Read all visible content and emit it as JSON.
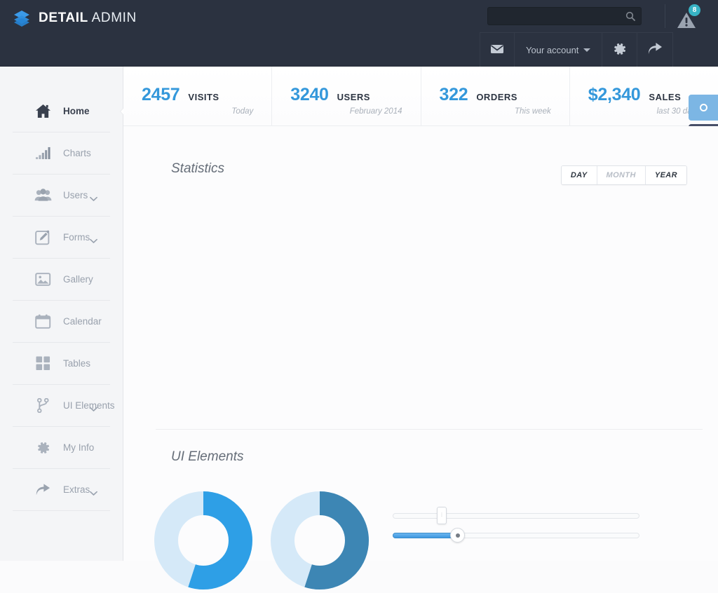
{
  "header": {
    "brand_bold": "DETAIL",
    "brand_light": " ADMIN",
    "logo_icon": "layers-icon",
    "search": {
      "value": "",
      "placeholder": "",
      "icon": "search-icon"
    },
    "alert": {
      "icon": "warning-triangle-icon",
      "badge_count": "8",
      "badge_color": "#37b3c4"
    },
    "tools": [
      {
        "name": "messages",
        "icon": "envelope-icon",
        "label": ""
      },
      {
        "name": "account",
        "icon": "caret-down-icon",
        "label": "Your account"
      },
      {
        "name": "settings",
        "icon": "gear-icon",
        "label": ""
      },
      {
        "name": "logout",
        "icon": "share-arrow-icon",
        "label": ""
      }
    ]
  },
  "sidebar": {
    "items": [
      {
        "label": "Home",
        "icon": "home-icon",
        "active": true,
        "expandable": false
      },
      {
        "label": "Charts",
        "icon": "bar-chart-icon",
        "active": false,
        "expandable": false
      },
      {
        "label": "Users",
        "icon": "users-icon",
        "active": false,
        "expandable": true
      },
      {
        "label": "Forms",
        "icon": "pencil-square-icon",
        "active": false,
        "expandable": true
      },
      {
        "label": "Gallery",
        "icon": "image-icon",
        "active": false,
        "expandable": false
      },
      {
        "label": "Calendar",
        "icon": "calendar-icon",
        "active": false,
        "expandable": false
      },
      {
        "label": "Tables",
        "icon": "grid-icon",
        "active": false,
        "expandable": false
      },
      {
        "label": "UI Elements",
        "icon": "sitemap-icon",
        "active": false,
        "expandable": true
      },
      {
        "label": "My Info",
        "icon": "gear-icon",
        "active": false,
        "expandable": false
      },
      {
        "label": "Extras",
        "icon": "share-arrow-icon",
        "active": false,
        "expandable": true
      }
    ]
  },
  "stats": [
    {
      "value": "2457",
      "label": "VISITS",
      "sub": "Today"
    },
    {
      "value": "3240",
      "label": "USERS",
      "sub": "February 2014"
    },
    {
      "value": "322",
      "label": "ORDERS",
      "sub": "This week"
    },
    {
      "value": "$2,340",
      "label": "SALES",
      "sub": "last 30 days"
    }
  ],
  "side_toggles": [
    {
      "name": "theme-toggle-light",
      "icon": "ring-icon",
      "color": "#7cb6e4"
    },
    {
      "name": "theme-toggle-dark",
      "icon": "dot-icon",
      "color": "#474f68"
    }
  ],
  "statistics": {
    "title": "Statistics",
    "range_buttons": [
      {
        "label": "DAY",
        "muted": false
      },
      {
        "label": "MONTH",
        "muted": true
      },
      {
        "label": "YEAR",
        "muted": false
      }
    ]
  },
  "ui_elements": {
    "title": "UI Elements",
    "donuts": [
      {
        "name": "donut-chart-1",
        "percent": 55,
        "color": "#2e9fe6",
        "track": "#d5e9f8"
      },
      {
        "name": "donut-chart-2",
        "percent": 55,
        "color": "#3d86b4",
        "track": "#d5e9f8"
      }
    ],
    "sliders": [
      {
        "name": "slider-plain",
        "value": 19,
        "filled": false
      },
      {
        "name": "slider-filled",
        "value": 26,
        "filled": true
      }
    ]
  },
  "colors": {
    "header_bg": "#2b3240",
    "sidebar_bg": "#f4f5f7",
    "accent_blue": "#3498db",
    "badge_teal": "#37b3c4"
  }
}
